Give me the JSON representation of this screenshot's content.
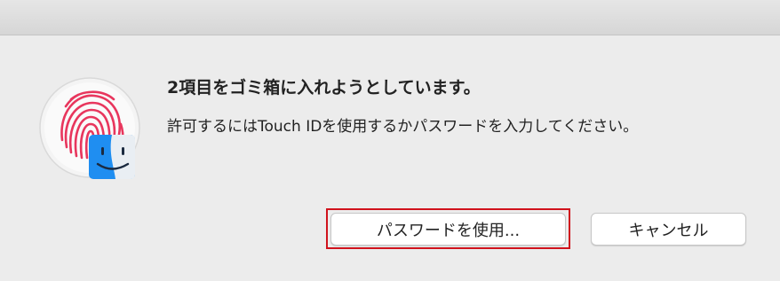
{
  "dialog": {
    "title": "2項目をゴミ箱に入れようとしています。",
    "message": "許可するにはTouch IDを使用するかパスワードを入力してください。",
    "icon": "touch-id-fingerprint-with-finder-icon",
    "buttons": {
      "use_password": "パスワードを使用...",
      "cancel": "キャンセル"
    },
    "highlight_color": "#d0121c",
    "fingerprint_color": "#e8365d"
  }
}
